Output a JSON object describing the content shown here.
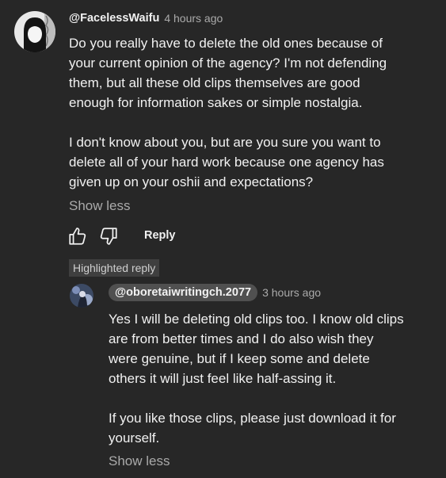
{
  "comment": {
    "author": "@FacelessWaifu",
    "time": "4 hours ago",
    "body": "Do you really have to delete the old ones because of\nyour current opinion of the agency? I'm not defending\nthem, but all these old clips themselves are good\nenough for information sakes or simple nostalgia.\n\nI don't know about you, but are you sure you want to\ndelete all of your hard work because one agency has\ngiven up on your oshii and expectations?",
    "show_less": "Show less",
    "reply_label": "Reply",
    "icons": {
      "like": "thumbs-up-icon",
      "dislike": "thumbs-down-icon"
    }
  },
  "reply": {
    "badge": "Highlighted reply",
    "author": "@oboretaiwritingch.2077",
    "time": "3 hours ago",
    "body": "Yes I will be deleting old clips too. I know old clips\nare from better times and I do also wish they\nwere genuine, but if I keep some and delete\nothers it will just feel like half-assing it.\n\nIf you like those clips, please just download it for\nyourself.",
    "show_less": "Show less"
  },
  "colors": {
    "background": "#272727",
    "text": "#f1f1f1",
    "secondary": "#aaaaaa",
    "badge_bg": "#3f3f3f",
    "pill_bg": "#505050"
  }
}
